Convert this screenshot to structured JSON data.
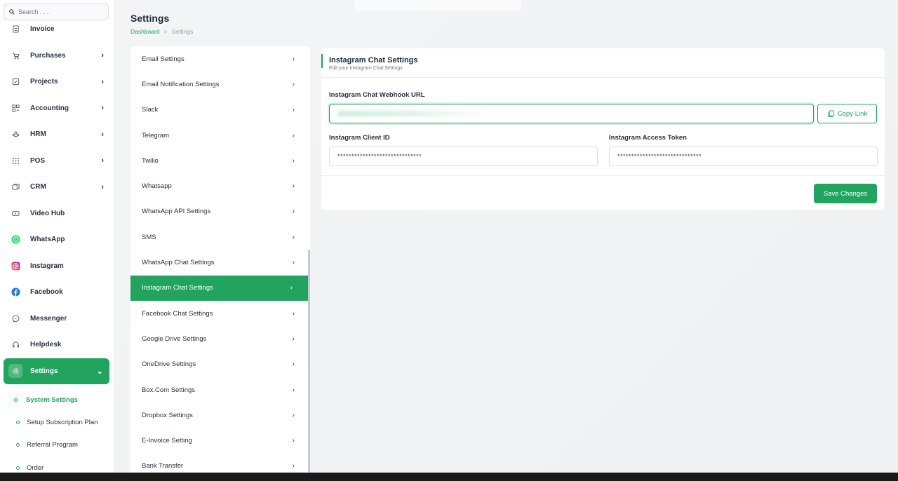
{
  "search": {
    "placeholder": "Search . . ."
  },
  "sidebar": {
    "items": [
      {
        "label": "Invoice",
        "icon": "invoice-icon",
        "chevron": false
      },
      {
        "label": "Purchases",
        "icon": "cart-icon",
        "chevron": true
      },
      {
        "label": "Projects",
        "icon": "check-square-icon",
        "chevron": true
      },
      {
        "label": "Accounting",
        "icon": "grid-icon",
        "chevron": true
      },
      {
        "label": "HRM",
        "icon": "users-icon",
        "chevron": true
      },
      {
        "label": "POS",
        "icon": "dots-grid-icon",
        "chevron": true
      },
      {
        "label": "CRM",
        "icon": "layers-icon",
        "chevron": true
      },
      {
        "label": "Video Hub",
        "icon": "video-icon",
        "chevron": false
      },
      {
        "label": "WhatsApp",
        "icon": "whatsapp-icon",
        "chevron": false
      },
      {
        "label": "Instagram",
        "icon": "instagram-icon",
        "chevron": false
      },
      {
        "label": "Facebook",
        "icon": "facebook-icon",
        "chevron": false
      },
      {
        "label": "Messenger",
        "icon": "messenger-icon",
        "chevron": false
      },
      {
        "label": "Helpdesk",
        "icon": "headset-icon",
        "chevron": false
      },
      {
        "label": "Settings",
        "icon": "gear-icon",
        "chevron": true
      }
    ],
    "submenu": [
      {
        "label": "System Settings"
      },
      {
        "label": "Setup Subscription Plan"
      },
      {
        "label": "Referral Program"
      },
      {
        "label": "Order"
      }
    ]
  },
  "header": {
    "title": "Settings",
    "breadcrumb_home": "Dashboard",
    "breadcrumb_sep": ">",
    "breadcrumb_current": "Settings"
  },
  "settings_list": [
    "Email Settings",
    "Email Notification Settings",
    "Slack",
    "Telegram",
    "Twilio",
    "Whatsapp",
    "WhatsApp API Settings",
    "SMS",
    "WhatsApp Chat Settings",
    "Instagram Chat Settings",
    "Facebook Chat Settings",
    "Google Drive Settings",
    "OneDrive Settings",
    "Box.Com Settings",
    "Dropbox Settings",
    "E-Invoice Setting",
    "Bank Transfer"
  ],
  "card": {
    "title": "Instagram Chat Settings",
    "subtitle": "Edit your Instagram Chat Settings",
    "webhook_label": "Instagram Chat Webhook URL",
    "copy_label": "Copy Link",
    "client_id_label": "Instagram Client ID",
    "client_id_value": "******************************",
    "access_token_label": "Instagram Access Token",
    "access_token_value": "******************************",
    "save_label": "Save Changes"
  },
  "colors": {
    "accent": "#22a35e"
  }
}
